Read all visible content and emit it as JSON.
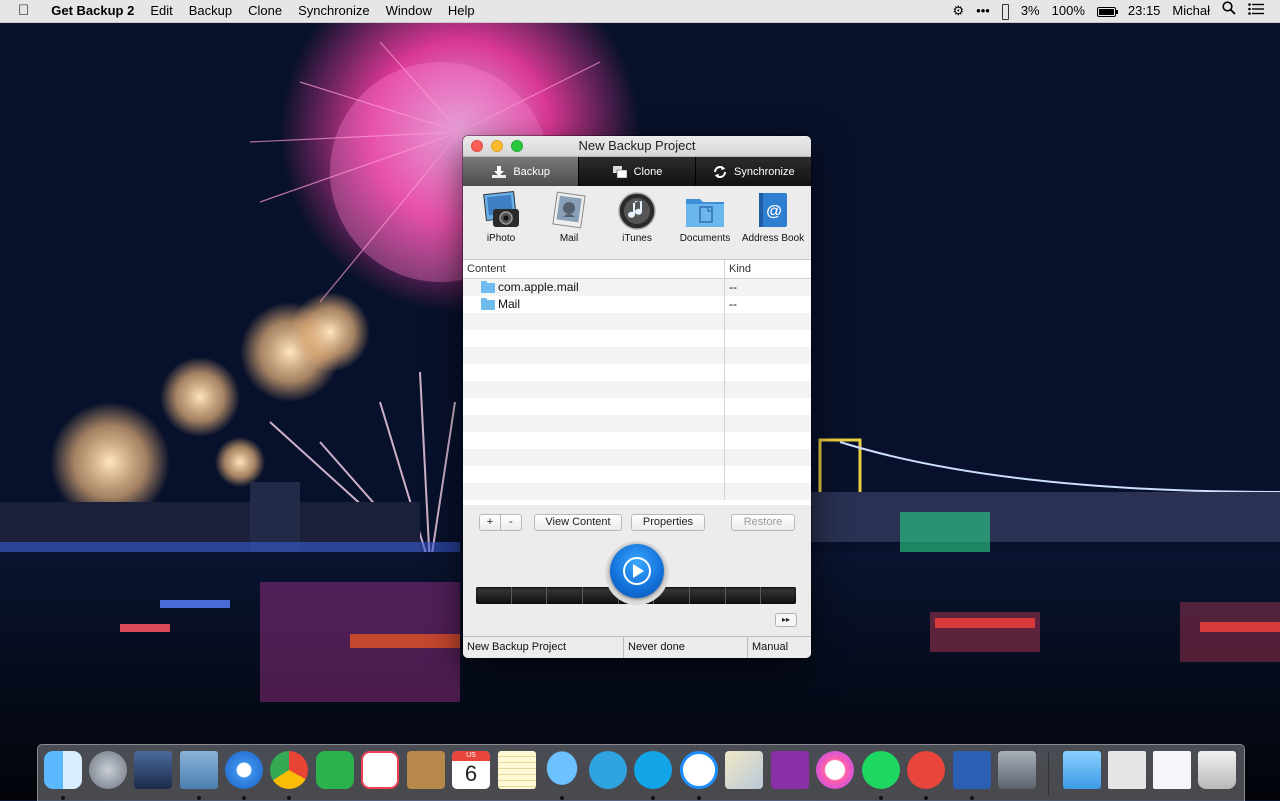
{
  "menubar": {
    "app_name": "Get Backup 2",
    "items": [
      "Edit",
      "Backup",
      "Clone",
      "Synchronize",
      "Window",
      "Help"
    ],
    "status": {
      "dots": "•••",
      "battery_small": "3%",
      "battery": "100%",
      "time": "23:15",
      "user": "Michał"
    }
  },
  "window": {
    "title": "New Backup Project",
    "tabs": [
      {
        "label": "Backup",
        "icon": "download-icon"
      },
      {
        "label": "Clone",
        "icon": "clone-icon"
      },
      {
        "label": "Synchronize",
        "icon": "sync-icon"
      }
    ],
    "categories": [
      {
        "label": "iPhoto",
        "icon": "iphoto-icon"
      },
      {
        "label": "Mail",
        "icon": "mail-icon"
      },
      {
        "label": "iTunes",
        "icon": "itunes-icon"
      },
      {
        "label": "Documents",
        "icon": "documents-folder-icon"
      },
      {
        "label": "Address Book",
        "icon": "address-book-icon"
      }
    ],
    "table": {
      "columns": [
        "Content",
        "Kind"
      ],
      "rows": [
        {
          "name": "com.apple.mail",
          "kind": "--"
        },
        {
          "name": "Mail",
          "kind": "--"
        }
      ]
    },
    "buttons": {
      "add": "+",
      "remove": "-",
      "view_content": "View Content",
      "properties": "Properties",
      "restore": "Restore",
      "fast_forward": "▸▸"
    },
    "statusbar": {
      "project": "New Backup Project",
      "last_run": "Never done",
      "schedule": "Manual"
    }
  },
  "dock": {
    "apps": [
      "Finder",
      "Launchpad",
      "Mission Control",
      "Mail",
      "Safari",
      "Chrome",
      "Feedly",
      "Pocket",
      "Contacts",
      "Calendar",
      "Notes",
      "Messages",
      "Telegram",
      "Skype",
      "Messenger",
      "Preview",
      "OneNote",
      "iTunes",
      "Spotify",
      "Get Backup",
      "Word",
      "Time Machine",
      "Folder",
      "Photo Booth",
      "Documents",
      "Trash"
    ],
    "calendar_month": "US",
    "calendar_day": "6"
  }
}
